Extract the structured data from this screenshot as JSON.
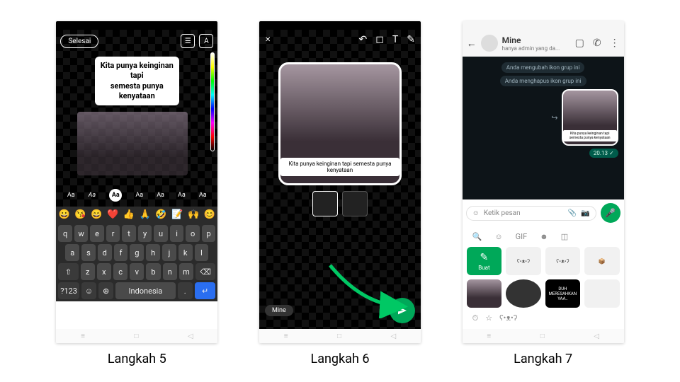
{
  "captions": {
    "l5": "Langkah 5",
    "l6": "Langkah 6",
    "l7": "Langkah 7"
  },
  "step5": {
    "done": "Selesai",
    "text": {
      "l1": "Kita punya keinginan",
      "l2": "tapi",
      "l3": "semesta punya",
      "l4": "kenyataan"
    },
    "fonts": [
      "Aa",
      "Aa",
      "Aa",
      "Aa",
      "Aa",
      "Aa",
      "Aa"
    ],
    "emojis": [
      "😀",
      "😘",
      "😄",
      "❤️",
      "👍",
      "🙏",
      "🤣",
      "📝",
      "🙌",
      "😊"
    ],
    "kb": {
      "r1": [
        "q",
        "w",
        "e",
        "r",
        "t",
        "y",
        "u",
        "i",
        "o",
        "p"
      ],
      "r2": [
        "a",
        "s",
        "d",
        "f",
        "g",
        "h",
        "j",
        "k",
        "l"
      ],
      "r3_shift": "⇧",
      "r3": [
        "z",
        "x",
        "c",
        "v",
        "b",
        "n",
        "m"
      ],
      "r3_bksp": "⌫",
      "r4_sym": "?123",
      "r4_emoji": "☺",
      "r4_globe": "⊕",
      "r4_space": "Indonesia",
      "r4_dot": ".",
      "r4_enter": "↵"
    }
  },
  "step6": {
    "close": "✕",
    "tools": {
      "undo": "↶",
      "crop": "◻",
      "text": "T",
      "draw": "✎"
    },
    "caption": "Kita punya keinginan tapi semesta punya kenyataan",
    "recipient": "Mine"
  },
  "step7": {
    "header": {
      "name": "Mine",
      "subtitle": "hanya admin yang da..."
    },
    "sys1": "Anda mengubah ikon grup ini",
    "sys2": "Anda menghapus ikon grup ini",
    "sticker_text": "Kita punya keinginan tapi semesta punya kenyataan",
    "time": "20.13 ✓",
    "placeholder": "Ketik pesan",
    "tabs": {
      "gif": "GIF"
    },
    "create": "Buat",
    "bubble": "DUH MERESAHKAN YAA.."
  }
}
